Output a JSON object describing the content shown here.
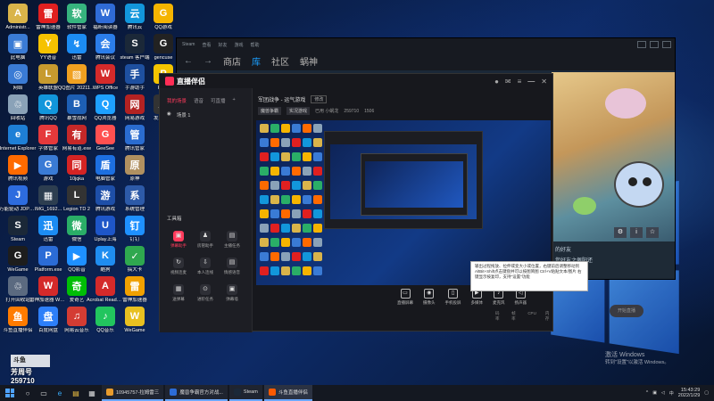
{
  "desktop": {
    "icons": [
      {
        "label": "Administr...",
        "color": "#d9b44a",
        "glyph": "A"
      },
      {
        "label": "此电脑",
        "color": "#3a7bd5",
        "glyph": "▣"
      },
      {
        "label": "网络",
        "color": "#3a7bd5",
        "glyph": "◎"
      },
      {
        "label": "回收站",
        "color": "#8aa2b8",
        "glyph": "♲"
      },
      {
        "label": "Internet Explorer",
        "color": "#1e7fd6",
        "glyph": "e"
      },
      {
        "label": "腾讯视频",
        "color": "#ff6a00",
        "glyph": "▶"
      },
      {
        "label": "万能驱动 JDPaint...",
        "color": "#2d6cdf",
        "glyph": "J"
      },
      {
        "label": "Steam",
        "color": "#1b2838",
        "glyph": "S"
      },
      {
        "label": "WeGame",
        "color": "#1d1d1d",
        "glyph": "G"
      },
      {
        "label": "打开回收站",
        "color": "#5b6a80",
        "glyph": "♲"
      },
      {
        "label": "斗鱼直播伴侣",
        "color": "#ff7b00",
        "glyph": "鱼"
      },
      {
        "label": "雷神加速器",
        "color": "#e02020",
        "glyph": "雷"
      },
      {
        "label": "YY语音",
        "color": "#f6c200",
        "glyph": "Y"
      },
      {
        "label": "英雄联盟",
        "color": "#c79a2e",
        "glyph": "L"
      },
      {
        "label": "腾讯QQ",
        "color": "#1296db",
        "glyph": "Q"
      },
      {
        "label": "字体管家",
        "color": "#e5393b",
        "glyph": "F"
      },
      {
        "label": "游戏",
        "color": "#3a7bd5",
        "glyph": "G"
      },
      {
        "label": "IMG_1692...",
        "color": "#2d3e50",
        "glyph": "▦"
      },
      {
        "label": "迅雷",
        "color": "#1c8cf3",
        "glyph": "迅"
      },
      {
        "label": "Platform.exe",
        "color": "#2b6cd6",
        "glyph": "P"
      },
      {
        "label": "雷神加速器 WeGame",
        "color": "#d42a2a",
        "glyph": "W"
      },
      {
        "label": "百度网盘",
        "color": "#2d7ff9",
        "glyph": "盘"
      },
      {
        "label": "软件管家",
        "color": "#36b37e",
        "glyph": "软"
      },
      {
        "label": "迅雷",
        "color": "#1c8cf3",
        "glyph": "↯"
      },
      {
        "label": "QQ图片 20211231...",
        "color": "#f0a020",
        "glyph": "▧"
      },
      {
        "label": "暴雪战网",
        "color": "#1d5fb4",
        "glyph": "B"
      },
      {
        "label": "网易有道.exe",
        "color": "#c52828",
        "glyph": "有"
      },
      {
        "label": "10jqka",
        "color": "#d42424",
        "glyph": "同"
      },
      {
        "label": "Legion TD 2",
        "color": "#333",
        "glyph": "L"
      },
      {
        "label": "微信",
        "color": "#2aae67",
        "glyph": "微"
      },
      {
        "label": "QQ影音",
        "color": "#1e90ff",
        "glyph": "▶"
      },
      {
        "label": "爱奇艺",
        "color": "#00be06",
        "glyph": "奇"
      },
      {
        "label": "网易云音乐",
        "color": "#d43c33",
        "glyph": "♫"
      },
      {
        "label": "福昕阅读器",
        "color": "#2f6bd6",
        "glyph": "W"
      },
      {
        "label": "腾讯会议",
        "color": "#2b7de9",
        "glyph": "会"
      },
      {
        "label": "WPS Office",
        "color": "#d42a2a",
        "glyph": "W"
      },
      {
        "label": "QQ浏览器",
        "color": "#1ea0ff",
        "glyph": "Q"
      },
      {
        "label": "GeeSee",
        "color": "#ff5050",
        "glyph": "G"
      },
      {
        "label": "电脑管家",
        "color": "#1d6fe0",
        "glyph": "盾"
      },
      {
        "label": "腾讯游戏",
        "color": "#1e4fa8",
        "glyph": "游"
      },
      {
        "label": "Uplay上海",
        "color": "#1e56c8",
        "glyph": "U"
      },
      {
        "label": "酷狗",
        "color": "#1f8df0",
        "glyph": "K"
      },
      {
        "label": "Acrobat Reader DC",
        "color": "#d42a2a",
        "glyph": "A"
      },
      {
        "label": "QQ音乐",
        "color": "#22c55e",
        "glyph": "♪"
      },
      {
        "label": "腾讯云",
        "color": "#1296db",
        "glyph": "云"
      },
      {
        "label": "steam 客户端",
        "color": "#1b2838",
        "glyph": "S"
      },
      {
        "label": "手游助手",
        "color": "#1e50a0",
        "glyph": "手"
      },
      {
        "label": "网易游戏",
        "color": "#b22222",
        "glyph": "网"
      },
      {
        "label": "腾讯管家",
        "color": "#2a6cd0",
        "glyph": "管"
      },
      {
        "label": "原神",
        "color": "#b09060",
        "glyph": "原"
      },
      {
        "label": "系统管理",
        "color": "#2d5aa8",
        "glyph": "系"
      },
      {
        "label": "钉钉",
        "color": "#1e90ff",
        "glyph": "钉"
      },
      {
        "label": "搞大卡",
        "color": "#2fa84f",
        "glyph": "✓"
      },
      {
        "label": "雷神加速器",
        "color": "#f0a000",
        "glyph": "雷"
      },
      {
        "label": "WeGame",
        "color": "#e8c020",
        "glyph": "W"
      },
      {
        "label": "QQ游戏",
        "color": "#f5b400",
        "glyph": "G"
      },
      {
        "label": "gencuse",
        "color": "#222",
        "glyph": "G"
      },
      {
        "label": "Pluto",
        "color": "#f4c400",
        "glyph": "P"
      },
      {
        "label": "发现新版",
        "color": "#333",
        "glyph": "发"
      }
    ]
  },
  "steam": {
    "title": "Steam",
    "nav": [
      "商店",
      "库",
      "社区",
      "蜗神"
    ],
    "menu": [
      "Steam",
      "查看",
      "好友",
      "游戏",
      "帮助"
    ],
    "lower_text_1": "的好友",
    "lower_text_2": "您好友之佩阳还",
    "lower_text_3": "好友与 聊天"
  },
  "companion": {
    "app_name": "直播伴侣",
    "tabs": [
      "我的场景",
      "语音",
      "可直播"
    ],
    "scene_item": "场景 1",
    "tools_title": "工具箱",
    "tools": [
      {
        "label": "弹幕助手",
        "glyph": "▣",
        "highlight": true
      },
      {
        "label": "房管助手",
        "glyph": "♟",
        "highlight": false
      },
      {
        "label": "主播任务",
        "glyph": "▤",
        "highlight": false
      },
      {
        "label": "视频连麦",
        "glyph": "↻",
        "highlight": false
      },
      {
        "label": "本人连线",
        "glyph": "⇩",
        "highlight": false
      },
      {
        "label": "情感语音",
        "glyph": "▤",
        "highlight": false
      },
      {
        "label": "送弹幕",
        "glyph": "▦",
        "highlight": false
      },
      {
        "label": "进阶任务",
        "glyph": "⊙",
        "highlight": false
      },
      {
        "label": "弹幕墙",
        "glyph": "▣",
        "highlight": false
      }
    ],
    "room_title": "军团战争 - 运气游戏",
    "edit_label": "修改",
    "tags": [
      "魔兽争霸",
      "实况游戏"
    ],
    "room_id": "已用 小蜗龙",
    "follower_count": "259710",
    "viewer_count": "1506",
    "bottom_controls": [
      {
        "label": "直播屏幕",
        "glyph": "▭"
      },
      {
        "label": "摄像头",
        "glyph": "◉"
      },
      {
        "label": "手机投屏",
        "glyph": "▯"
      },
      {
        "label": "多媒体",
        "glyph": "▶"
      },
      {
        "label": "麦克风",
        "glyph": "♪"
      },
      {
        "label": "扬声器",
        "glyph": "◁"
      }
    ],
    "stats": [
      "码率",
      "帧率",
      "CPU",
      "内存"
    ],
    "start_button": "开始直播",
    "tooltip": "输出过程拖放、拉伸或变大小或位置，右键前后调整移动到AltBit+Shift点击键盘并可以按图简图 Ctrl+V粘贴文本/图片 右键显示按复印，支持\"设置\"功能"
  },
  "overlay": {
    "badge": "斗鱼",
    "name": "芳周号",
    "number": "259710"
  },
  "activation": {
    "line1": "激活 Windows",
    "line2": "转到\"设置\"以激活 Windows。"
  },
  "taskbar": {
    "tasks": [
      {
        "label": "10945757-拉姆雷三",
        "color": "#e89b2c",
        "active": false
      },
      {
        "label": "魔兽争霸官方对战...",
        "color": "#2d6cd6",
        "active": false
      },
      {
        "label": "Steam",
        "color": "#1b2838",
        "active": false
      },
      {
        "label": "斗鱼直播伴侣",
        "color": "#ff5a00",
        "active": true
      }
    ],
    "tray_lang": "中",
    "time": "15:43:29",
    "date": "2022/1/29"
  }
}
